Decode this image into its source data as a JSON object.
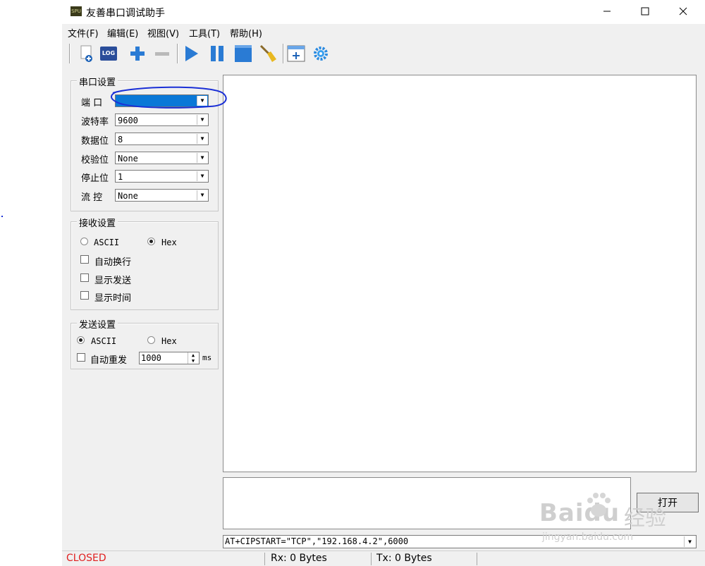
{
  "window": {
    "title": "友善串口调试助手",
    "app_icon_text": "SPU",
    "controls": {
      "minimize": "—",
      "maximize": "☐",
      "close": "✕"
    }
  },
  "menu": [
    {
      "label": "文件(F)"
    },
    {
      "label": "编辑(E)"
    },
    {
      "label": "视图(V)"
    },
    {
      "label": "工具(T)"
    },
    {
      "label": "帮助(H)"
    }
  ],
  "toolbar": {
    "log_label": "LOG",
    "icons": [
      "new-file-icon",
      "log-icon",
      "add-icon",
      "remove-icon",
      "play-icon",
      "pause-icon",
      "stop-icon",
      "clear-broom-icon",
      "add-window-icon",
      "settings-gear-icon"
    ]
  },
  "serial_settings": {
    "title": "串口设置",
    "port_label": "端  口",
    "port_value": "",
    "baud_label": "波特率",
    "baud_value": "9600",
    "databits_label": "数据位",
    "databits_value": "8",
    "parity_label": "校验位",
    "parity_value": "None",
    "stopbits_label": "停止位",
    "stopbits_value": "1",
    "flow_label": "流  控",
    "flow_value": "None"
  },
  "receive_settings": {
    "title": "接收设置",
    "ascii_label": "ASCII",
    "hex_label": "Hex",
    "selected": "Hex",
    "auto_newline_label": "自动换行",
    "show_send_label": "显示发送",
    "show_time_label": "显示时间"
  },
  "send_settings": {
    "title": "发送设置",
    "ascii_label": "ASCII",
    "hex_label": "Hex",
    "selected": "ASCII",
    "auto_resend_label": "自动重发",
    "interval_value": "1000",
    "interval_unit": "ms"
  },
  "send_area": {
    "open_button_label": "打开",
    "command_value": "AT+CIPSTART=\"TCP\",\"192.168.4.2\",6000"
  },
  "status_bar": {
    "state": "CLOSED",
    "state_color": "#e02020",
    "rx": "Rx: 0 Bytes",
    "tx": "Tx: 0 Bytes"
  },
  "annotation": {
    "color": "#1a2fd6"
  },
  "watermark": {
    "brand": "Baidu",
    "cn": "经验",
    "url": "jingyan.baidu.com"
  }
}
